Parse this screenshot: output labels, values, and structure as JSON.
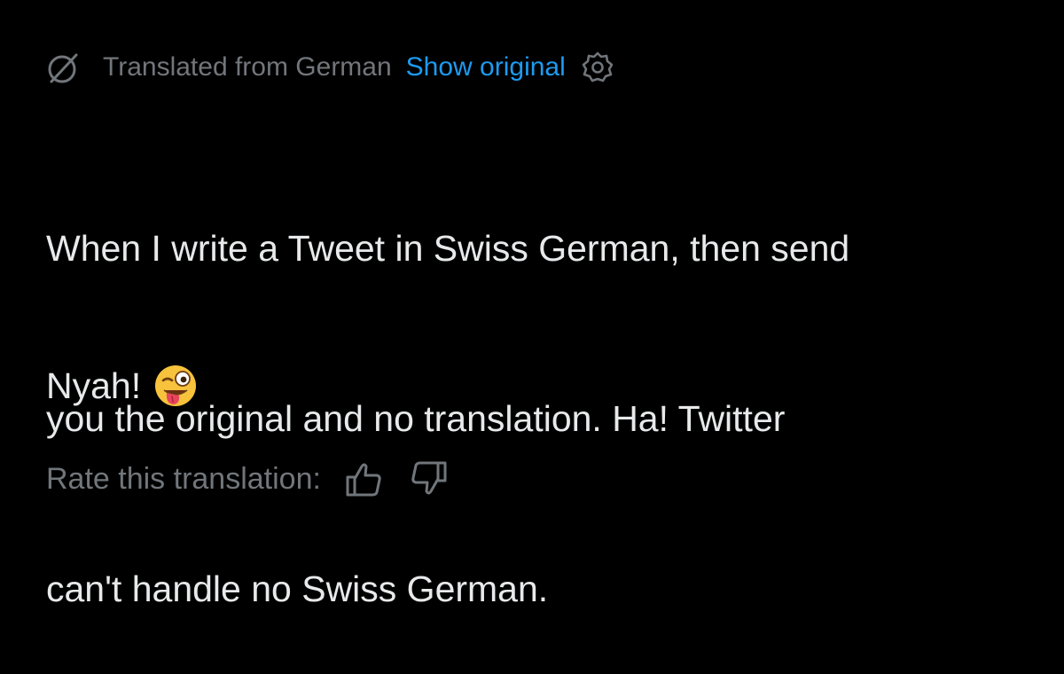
{
  "translation": {
    "header_text": "Translated from German",
    "show_original_label": "Show original",
    "icons": {
      "translate": "translate-icon",
      "settings": "gear-icon"
    }
  },
  "tweet": {
    "lines": [
      "When I write a Tweet in Swiss German, then send",
      "you the original and no translation. Ha! Twitter",
      "can't handle no Swiss German."
    ],
    "closing": "Nyah!",
    "emoji": "winking-face-with-tongue-emoji"
  },
  "rating": {
    "label": "Rate this translation:",
    "icons": {
      "up": "thumbs-up-icon",
      "down": "thumbs-down-icon"
    }
  },
  "colors": {
    "background": "#000000",
    "text": "#e7e9ea",
    "muted": "#71767b",
    "link": "#1d9bf0"
  }
}
